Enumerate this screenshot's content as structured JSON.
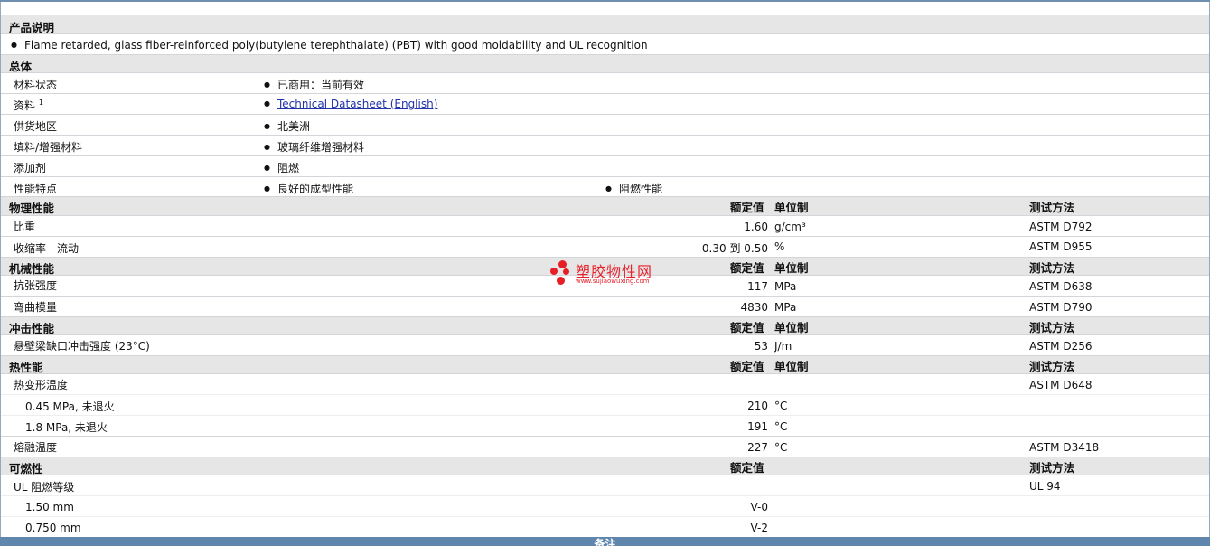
{
  "sections": {
    "desc": "产品说明",
    "general": "总体",
    "physical": "物理性能",
    "mechanical": "机械性能",
    "impact": "冲击性能",
    "thermal": "热性能",
    "flammability": "可燃性",
    "notes": "备注"
  },
  "headers": {
    "nominal": "额定值",
    "unit": "单位制",
    "method": "测试方法"
  },
  "description": "Flame retarded, glass fiber-reinforced poly(butylene terephthalate) (PBT) with good moldability and UL recognition",
  "general": {
    "status_label": "材料状态",
    "status_value": "已商用：当前有效",
    "docs_label": "资料",
    "docs_sup": "1",
    "docs_link": "Technical Datasheet (English)",
    "region_label": "供货地区",
    "region_value": "北美洲",
    "filler_label": "填料/增强材料",
    "filler_value": "玻璃纤维增强材料",
    "additive_label": "添加剂",
    "additive_value": "阻燃",
    "features_label": "性能特点",
    "features_value1": "良好的成型性能",
    "features_value2": "阻燃性能"
  },
  "physical": {
    "density_label": "比重",
    "density_value": "1.60",
    "density_unit": "g/cm³",
    "density_method": "ASTM D792",
    "shrink_label": "收缩率  - 流动",
    "shrink_value": "0.30 到  0.50",
    "shrink_unit": "%",
    "shrink_method": "ASTM D955"
  },
  "mechanical": {
    "tensile_label": "抗张强度",
    "tensile_value": "117",
    "tensile_unit": "MPa",
    "tensile_method": "ASTM D638",
    "flex_label": "弯曲模量",
    "flex_value": "4830",
    "flex_unit": "MPa",
    "flex_method": "ASTM D790"
  },
  "impact": {
    "izod_label": "悬壁梁缺口冲击强度  (23°C)",
    "izod_value": "53",
    "izod_unit": "J/m",
    "izod_method": "ASTM D256"
  },
  "thermal": {
    "hdt_label": "热变形温度",
    "hdt_method": "ASTM D648",
    "hdt1_label": "0.45 MPa, 未退火",
    "hdt1_value": "210",
    "hdt1_unit": "°C",
    "hdt2_label": "1.8 MPa, 未退火",
    "hdt2_value": "191",
    "hdt2_unit": "°C",
    "melt_label": "熔融温度",
    "melt_value": "227",
    "melt_unit": "°C",
    "melt_method": "ASTM D3418"
  },
  "flammability": {
    "ul_label": "UL 阻燃等级",
    "ul_method": "UL 94",
    "ul1_label": "1.50 mm",
    "ul1_value": "V-0",
    "ul2_label": "0.750 mm",
    "ul2_value": "V-2"
  },
  "watermark": {
    "title": "塑胶物性网",
    "url": "www.sujiaowuxing.com",
    "color": "#e61e25"
  }
}
